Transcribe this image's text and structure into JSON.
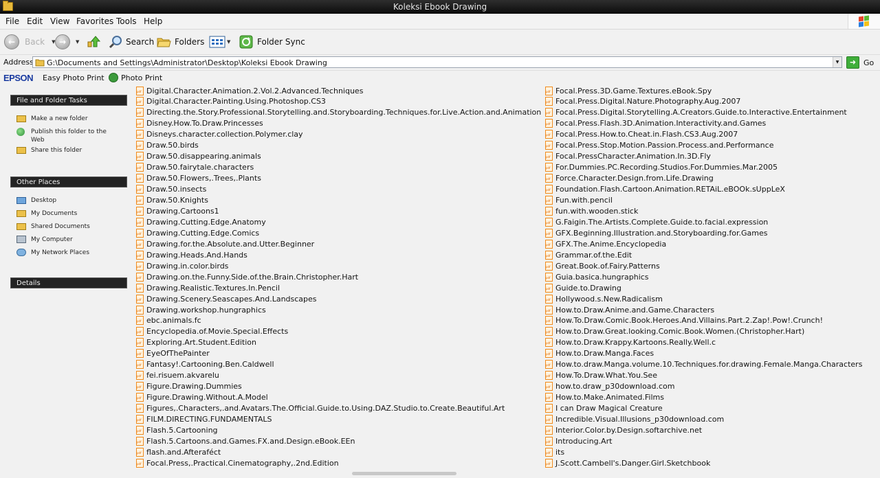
{
  "window": {
    "title": "Koleksi Ebook Drawing"
  },
  "menu": [
    "File",
    "Edit",
    "View",
    "Favorites",
    "Tools",
    "Help"
  ],
  "toolbar": {
    "back": "Back",
    "search": "Search",
    "folders": "Folders",
    "folder_sync": "Folder Sync"
  },
  "address": {
    "label": "Address",
    "path": "G:\\Documents and Settings\\Administrator\\Desktop\\Koleksi Ebook Drawing",
    "go": "Go"
  },
  "epson": {
    "logo": "EPSON",
    "easy_photo_print": "Easy Photo Print",
    "photo_print": "Photo Print"
  },
  "tasks": {
    "heading": "File and Folder Tasks",
    "items": [
      {
        "label": "Make a new folder",
        "icon": "new-folder-icon"
      },
      {
        "label": "Publish this folder to the Web",
        "icon": "web-publish-icon"
      },
      {
        "label": "Share this folder",
        "icon": "share-folder-icon"
      }
    ]
  },
  "other_places": {
    "heading": "Other Places",
    "items": [
      {
        "label": "Desktop",
        "icon": "desktop-icon"
      },
      {
        "label": "My Documents",
        "icon": "my-documents-icon"
      },
      {
        "label": "Shared Documents",
        "icon": "shared-documents-icon"
      },
      {
        "label": "My Computer",
        "icon": "my-computer-icon"
      },
      {
        "label": "My Network Places",
        "icon": "network-places-icon"
      }
    ]
  },
  "details": {
    "heading": "Details"
  },
  "files": {
    "column1": [
      "Digital.Character.Animation.2.Vol.2.Advanced.Techniques",
      "Digital.Character.Painting.Using.Photoshop.CS3",
      "Directing.the.Story.Professional.Storytelling.and.Storyboarding.Techniques.for.Live.Action.and.Animation",
      "Disney.How.To.Draw.Princesses",
      "Disneys.character.collection.Polymer.clay",
      "Draw.50.birds",
      "Draw.50.disappearing.animals",
      "Draw.50.fairytale.characters",
      "Draw.50.Flowers,.Trees,.Plants",
      "Draw.50.insects",
      "Draw.50.Knights",
      "Drawing.Cartoons1",
      "Drawing.Cutting.Edge.Anatomy",
      "Drawing.Cutting.Edge.Comics",
      "Drawing.for.the.Absolute.and.Utter.Beginner",
      "Drawing.Heads.And.Hands",
      "Drawing.in.color.birds",
      "Drawing.on.the.Funny.Side.of.the.Brain.Christopher.Hart",
      "Drawing.Realistic.Textures.In.Pencil",
      "Drawing.Scenery.Seascapes.And.Landscapes",
      "Drawing.workshop.hungraphics",
      "ebc.animals.fc",
      "Encyclopedia.of.Movie.Special.Effects",
      "Exploring.Art.Student.Edition",
      "EyeOfThePainter",
      "Fantasy!.Cartooning.Ben.Caldwell",
      "fei.risuem.akvarelu",
      "Figure.Drawing.Dummies",
      "Figure.Drawing.Without.A.Model",
      "Figures,.Characters,.and.Avatars.The.Official.Guide.to.Using.DAZ.Studio.to.Create.Beautiful.Art",
      "FILM.DIRECTING.FUNDAMENTALS",
      "Flash.5.Cartooning",
      "Flash.5.Cartoons.and.Games.FX.and.Design.eBook.EEn",
      "flash.and.Afteraféct",
      "Focal.Press,.Practical.Cinematography,.2nd.Edition"
    ],
    "column2": [
      "Focal.Press.3D.Game.Textures.eBook.Spy",
      "Focal.Press.Digital.Nature.Photography.Aug.2007",
      "Focal.Press.Digital.Storytelling.A.Creators.Guide.to.Interactive.Entertainment",
      "Focal.Press.Flash.3D.Animation.Interactivity.and.Games",
      "Focal.Press.How.to.Cheat.in.Flash.CS3.Aug.2007",
      "Focal.Press.Stop.Motion.Passion.Process.and.Performance",
      "Focal.PressCharacter.Animation.In.3D.Fly",
      "For.Dummies.PC.Recording.Studios.For.Dummies.Mar.2005",
      "Force.Character.Design.from.Life.Drawing",
      "Foundation.Flash.Cartoon.Animation.RETAiL.eBOOk.sUppLeX",
      "Fun.with.pencil",
      "fun.with.wooden.stick",
      "G.Faigin.The.Artists.Complete.Guide.to.facial.expression",
      "GFX.Beginning.Illustration.and.Storyboarding.for.Games",
      "GFX.The.Anime.Encyclopedia",
      "Grammar.of.the.Edit",
      "Great.Book.of.Fairy.Patterns",
      "Guia.basica.hungraphics",
      "Guide.to.Drawing",
      "Hollywood.s.New.Radicalism",
      "How.to.Draw.Anime.and.Game.Characters",
      "How.To.Draw.Comic.Book.Heroes.And.Villains.Part.2.Zap!.Pow!.Crunch!",
      "How.to.Draw.Great.looking.Comic.Book.Women.(Christopher.Hart)",
      "How.to.Draw.Krappy.Kartoons.Really.Well.c",
      "How.to.Draw.Manga.Faces",
      "How.to.draw.Manga.volume.10.Techniques.for.drawing.Female.Manga.Characters",
      "How.To.Draw.What.You.See",
      "how.to.draw_p30download.com",
      "How.to.Make.Animated.Films",
      "I can Draw Magical Creature",
      "Incredible.Visual.Illusions_p30download.com",
      "Interior.Color.by.Design.softarchive.net",
      "Introducing.Art",
      "its",
      "J.Scott.Cambell's.Danger.Girl.Sketchbook"
    ]
  }
}
